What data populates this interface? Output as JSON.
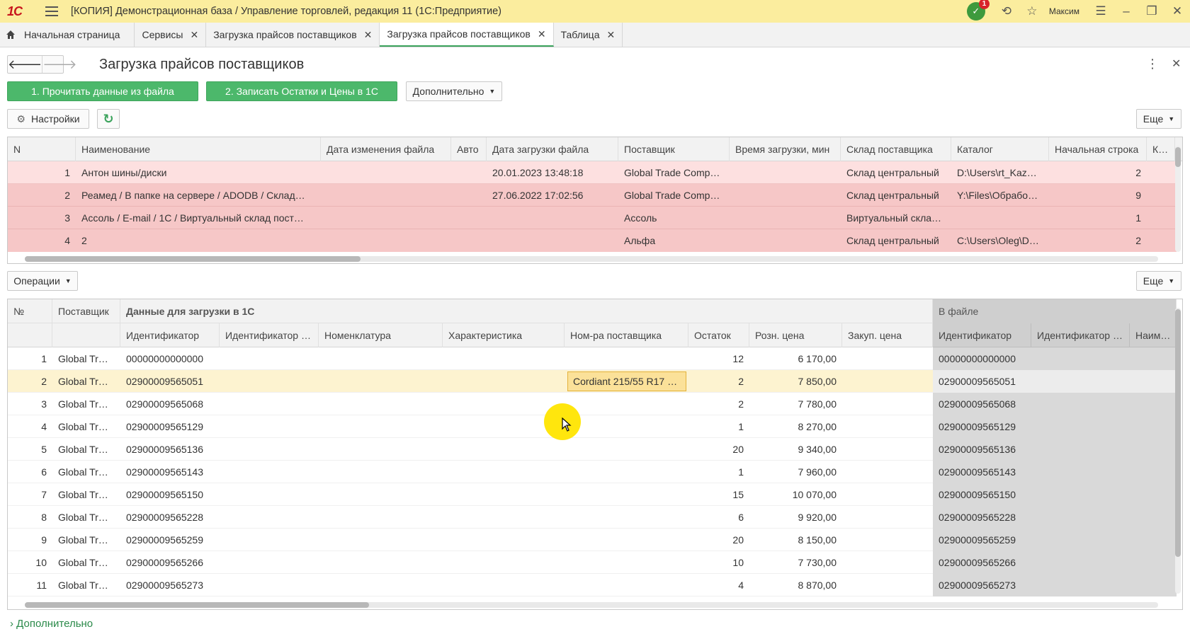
{
  "titlebar": {
    "logo": "1С",
    "title": "[КОПИЯ] Демонстрационная база / Управление торговлей, редакция 11  (1С:Предприятие)",
    "notifications_count": "1",
    "user": "Максим"
  },
  "tabs": [
    {
      "label": "Начальная страница",
      "closable": false
    },
    {
      "label": "Сервисы",
      "closable": true
    },
    {
      "label": "Загрузка прайсов поставщиков",
      "closable": true
    },
    {
      "label": "Загрузка прайсов поставщиков",
      "closable": true,
      "active": true
    },
    {
      "label": "Таблица",
      "closable": true
    }
  ],
  "form": {
    "title": "Загрузка прайсов поставщиков",
    "btn_read": "1. Прочитать данные из файла",
    "btn_write": "2. Записать Остатки и Цены в 1С",
    "btn_more_actions": "Дополнительно",
    "btn_settings": "Настройки",
    "btn_more_top": "Еще",
    "btn_operations": "Операции",
    "btn_more_bottom": "Еще",
    "footer": "Дополнительно"
  },
  "suppliers_table": {
    "columns": [
      "N",
      "Наименование",
      "Дата изменения файла",
      "Авто",
      "Дата загрузки файла",
      "Поставщик",
      "Время загрузки, мин",
      "Склад поставщика",
      "Каталог",
      "Начальная строка",
      "Кол"
    ],
    "rows": [
      [
        "1",
        "Антон шины/диски",
        "",
        "",
        "20.01.2023 13:48:18",
        "Global Trade Comp…",
        "",
        "Склад центральный",
        "D:\\Users\\rt_Kaz…",
        "2"
      ],
      [
        "2",
        "Реамед / В папке на сервере / ADODB / Склад…",
        "",
        "",
        "27.06.2022 17:02:56",
        "Global Trade Comp…",
        "",
        "Склад центральный",
        "Y:\\Files\\Обрабо…",
        "9"
      ],
      [
        "3",
        "Ассоль / E-mail / 1С / Виртуальный склад пост…",
        "",
        "",
        "",
        "Ассоль",
        "",
        "Виртуальный скла…",
        "",
        "1"
      ],
      [
        "4",
        "2",
        "",
        "",
        "",
        "Альфа",
        "",
        "Склад центральный",
        "C:\\Users\\Oleg\\D…",
        "2"
      ]
    ]
  },
  "data_table": {
    "group_header_1c": "Данные для загрузки в 1С",
    "group_header_file": "В файле",
    "col_num": "№",
    "col_supplier": "Поставщик",
    "columns_1c": [
      "Идентификатор",
      "Идентификатор …",
      "Номенклатура",
      "Характеристика",
      "Ном-ра поставщика",
      "Остаток",
      "Розн. цена",
      "Закуп. цена"
    ],
    "columns_file": [
      "Идентификатор",
      "Идентификатор …",
      "Наимен"
    ],
    "rows": [
      [
        "1",
        "Global Tr…",
        "00000000000000",
        "12",
        "6 170,00",
        "00000000000000"
      ],
      [
        "2",
        "Global Tr…",
        "02900009565051",
        "2",
        "7 850,00",
        "02900009565051"
      ],
      [
        "3",
        "Global Tr…",
        "02900009565068",
        "2",
        "7 780,00",
        "02900009565068"
      ],
      [
        "4",
        "Global Tr…",
        "02900009565129",
        "1",
        "8 270,00",
        "02900009565129"
      ],
      [
        "5",
        "Global Tr…",
        "02900009565136",
        "20",
        "9 340,00",
        "02900009565136"
      ],
      [
        "6",
        "Global Tr…",
        "02900009565143",
        "1",
        "7 960,00",
        "02900009565143"
      ],
      [
        "7",
        "Global Tr…",
        "02900009565150",
        "15",
        "10 070,00",
        "02900009565150"
      ],
      [
        "8",
        "Global Tr…",
        "02900009565228",
        "6",
        "9 920,00",
        "02900009565228"
      ],
      [
        "9",
        "Global Tr…",
        "02900009565259",
        "20",
        "8 150,00",
        "02900009565259"
      ],
      [
        "10",
        "Global Tr…",
        "02900009565266",
        "10",
        "7 730,00",
        "02900009565266"
      ],
      [
        "11",
        "Global Tr…",
        "02900009565273",
        "4",
        "8 870,00",
        "02900009565273"
      ]
    ],
    "selected_row": 1,
    "editing_cell_value": "Cordiant 215/55 R17 …"
  },
  "colors": {
    "titlebar": "#fbed9e",
    "accent_green": "#4cb86b",
    "error_row": "#f6c7c7",
    "selected_row": "#fdf3d0",
    "file_section": "#d9d9d9"
  }
}
